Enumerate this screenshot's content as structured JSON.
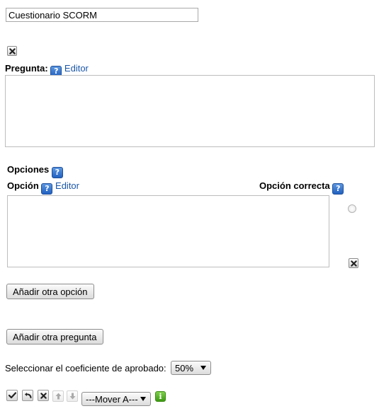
{
  "quiz": {
    "title_value": "Cuestionario SCORM"
  },
  "question": {
    "label": "Pregunta:",
    "editor_link": "Editor",
    "help_glyph": "?"
  },
  "options": {
    "section_label": "Opciones",
    "option_label": "Opción",
    "editor_link": "Editor",
    "correct_label": "Opción correcta",
    "help_glyph": "?",
    "add_option_button": "Añadir otra opción"
  },
  "add_question_button": "Añadir otra pregunta",
  "pass_rate": {
    "label": "Seleccionar el coeficiente de aprobado:",
    "selected": "50%"
  },
  "toolbar": {
    "move_select": "---Mover A---",
    "info_glyph": "i",
    "icons": [
      "check-icon",
      "undo-icon",
      "delete-icon",
      "move-up-icon",
      "move-down-icon",
      "info-icon"
    ]
  },
  "colors": {
    "link": "#1a56a8",
    "help_blue": "#2261c0",
    "info_green": "#3c9a12"
  }
}
